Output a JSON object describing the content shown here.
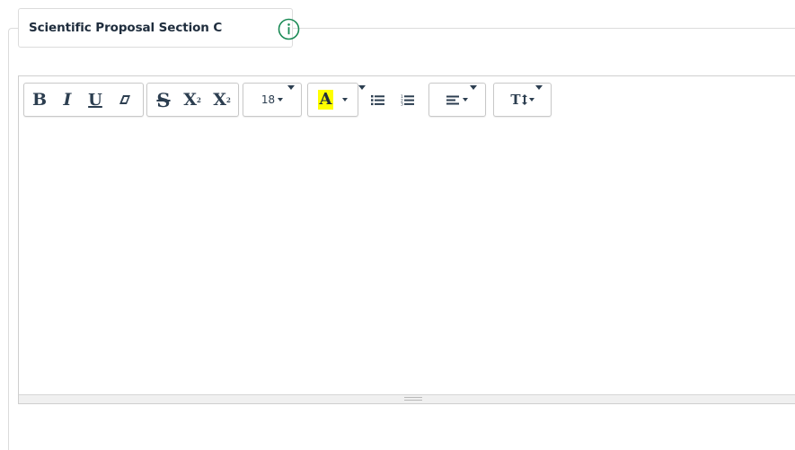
{
  "section": {
    "title": "Scientific Proposal Section C",
    "info_icon": "info-circle-icon",
    "accent_color": "#1a8a55"
  },
  "toolbar": {
    "bold": "B",
    "italic": "I",
    "underline": "U",
    "eraser_icon": "eraser-icon",
    "strikethrough": "S",
    "superscript": "X",
    "superscript_mark": "2",
    "subscript": "X",
    "subscript_mark": "2",
    "font_size": "18",
    "highlight": "A",
    "highlight_color": "#ffff00",
    "unordered_list_icon": "unordered-list-icon",
    "ordered_list_icon": "ordered-list-icon",
    "align_icon": "align-left-icon",
    "line_height_label": "T"
  },
  "editor": {
    "content": ""
  }
}
